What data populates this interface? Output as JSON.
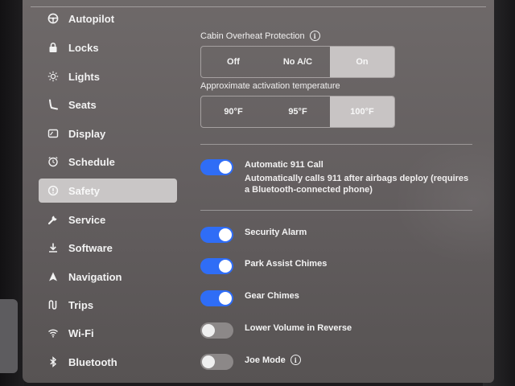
{
  "sidebar": {
    "items": [
      {
        "label": "Autopilot",
        "icon": "steering-wheel-icon",
        "active": false
      },
      {
        "label": "Locks",
        "icon": "lock-icon",
        "active": false
      },
      {
        "label": "Lights",
        "icon": "sun-icon",
        "active": false
      },
      {
        "label": "Seats",
        "icon": "seat-icon",
        "active": false
      },
      {
        "label": "Display",
        "icon": "display-icon",
        "active": false
      },
      {
        "label": "Schedule",
        "icon": "clock-icon",
        "active": false
      },
      {
        "label": "Safety",
        "icon": "alert-circle-icon",
        "active": true
      },
      {
        "label": "Service",
        "icon": "wrench-icon",
        "active": false
      },
      {
        "label": "Software",
        "icon": "download-icon",
        "active": false
      },
      {
        "label": "Navigation",
        "icon": "navigation-arrow-icon",
        "active": false
      },
      {
        "label": "Trips",
        "icon": "trips-icon",
        "active": false
      },
      {
        "label": "Wi-Fi",
        "icon": "wifi-icon",
        "active": false
      },
      {
        "label": "Bluetooth",
        "icon": "bluetooth-icon",
        "active": false
      }
    ]
  },
  "cabin_overheat": {
    "title": "Cabin Overheat Protection",
    "options": [
      "Off",
      "No A/C",
      "On"
    ],
    "selected": "On"
  },
  "activation_temp": {
    "title": "Approximate activation temperature",
    "options": [
      "90°F",
      "95°F",
      "100°F"
    ],
    "selected": "100°F"
  },
  "auto_911": {
    "label": "Automatic 911 Call",
    "description": "Automatically calls 911 after airbags deploy (requires a Bluetooth-connected phone)",
    "on": true
  },
  "toggles": [
    {
      "label": "Security Alarm",
      "on": true
    },
    {
      "label": "Park Assist Chimes",
      "on": true
    },
    {
      "label": "Gear Chimes",
      "on": true
    },
    {
      "label": "Lower Volume in Reverse",
      "on": false
    },
    {
      "label": "Joe Mode",
      "on": false,
      "info": true
    }
  ],
  "colors": {
    "toggle_on": "#2f6df6",
    "toggle_off": "#8c8888",
    "selected_segment": "#c8c4c4",
    "active_sidebar": "#c9c6c6"
  }
}
